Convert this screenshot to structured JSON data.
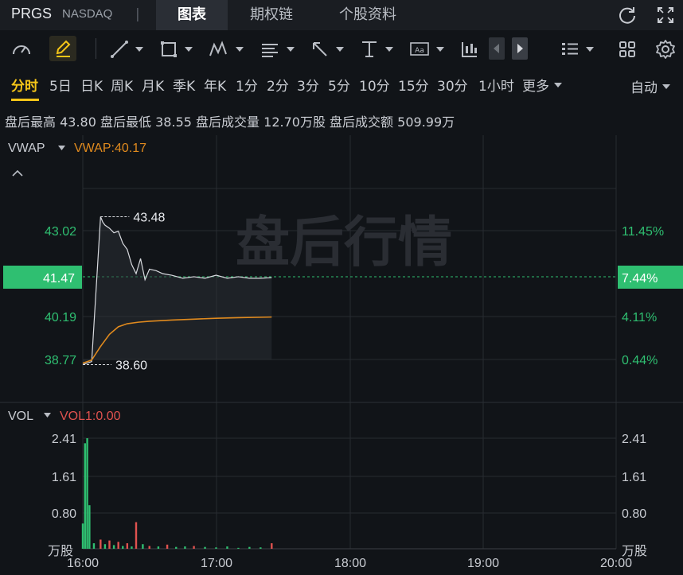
{
  "header": {
    "ticker": "PRGS",
    "exchange": "NASDAQ",
    "separator": "|",
    "tabs": [
      {
        "label": "图表",
        "active": true
      },
      {
        "label": "期权链",
        "active": false
      },
      {
        "label": "个股资料",
        "active": false
      }
    ],
    "icons": [
      "refresh-icon",
      "fullscreen-icon"
    ]
  },
  "toolbar": {
    "icons": [
      "gauge-icon",
      "pen-icon",
      "trend-line-icon",
      "rectangle-icon",
      "pattern-icon",
      "fibonacci-icon",
      "arrow-icon",
      "level-icon",
      "text-icon",
      "indicator-icon",
      "prev-icon",
      "next-icon",
      "layout-icon",
      "grid-icon",
      "settings-icon"
    ]
  },
  "periods": {
    "items": [
      "分时",
      "5日",
      "日K",
      "周K",
      "月K",
      "季K",
      "年K",
      "1分",
      "2分",
      "3分",
      "5分",
      "10分",
      "15分",
      "30分",
      "1小时",
      "更多"
    ],
    "active": "分时",
    "auto_label": "自动"
  },
  "info": {
    "items": [
      {
        "label": "盘后最高",
        "value": "43.80"
      },
      {
        "label": "盘后最低",
        "value": "38.55"
      },
      {
        "label": "盘后成交量",
        "value": "12.70万股"
      },
      {
        "label": "盘后成交额",
        "value": "509.99万"
      }
    ]
  },
  "price_panel": {
    "indicator": "VWAP",
    "indicator_value": "VWAP:40.17",
    "watermark": "盘后行情",
    "left_ticks": [
      "43.02",
      "41.47",
      "40.19",
      "38.77"
    ],
    "right_ticks": [
      "11.45%",
      "7.44%",
      "4.11%",
      "0.44%"
    ],
    "current_price": "41.47",
    "current_pct": "7.44%",
    "high_label": "43.48",
    "low_label": "38.60",
    "collapse_icon": "chevron-up-icon"
  },
  "volume_panel": {
    "indicator": "VOL",
    "indicator_value": "VOL1:0.00",
    "left_ticks": [
      "2.41",
      "1.61",
      "0.80"
    ],
    "right_ticks": [
      "2.41",
      "1.61",
      "0.80"
    ],
    "unit_left": "万股",
    "unit_right": "万股"
  },
  "time_axis": [
    "16:00",
    "17:00",
    "18:00",
    "19:00",
    "20:00"
  ],
  "colors": {
    "background": "#111418",
    "accent": "#f5c518",
    "up": "#2fbf71",
    "down": "#e0524f",
    "vwap": "#e08a1e",
    "price_line": "#d8dadf"
  },
  "chart_data": [
    {
      "type": "line",
      "title": "",
      "x_range": [
        "16:00",
        "20:00"
      ],
      "ylim": [
        38.0,
        44.5
      ],
      "series": [
        {
          "name": "",
          "x": [
            "16:00",
            "16:04",
            "16:08",
            "16:09",
            "16:10",
            "16:12",
            "16:14",
            "16:16",
            "16:18",
            "16:20",
            "16:22",
            "16:24",
            "16:26",
            "16:28",
            "16:30",
            "16:33",
            "16:36",
            "16:40",
            "16:45",
            "16:50",
            "16:55",
            "17:00",
            "17:05",
            "17:10",
            "17:15",
            "17:20",
            "17:25"
          ],
          "values": [
            38.6,
            38.7,
            43.48,
            43.3,
            43.2,
            43.1,
            42.95,
            43.0,
            42.6,
            42.4,
            41.9,
            41.6,
            42.1,
            41.4,
            41.75,
            41.7,
            41.6,
            41.55,
            41.45,
            41.5,
            41.45,
            41.55,
            41.45,
            41.5,
            41.45,
            41.45,
            41.47
          ]
        },
        {
          "name": "VWAP",
          "x": [
            "16:00",
            "16:04",
            "16:08",
            "16:12",
            "16:16",
            "16:20",
            "16:25",
            "16:30",
            "16:40",
            "16:50",
            "17:00",
            "17:10",
            "17:25"
          ],
          "values": [
            38.65,
            38.75,
            39.2,
            39.6,
            39.85,
            39.95,
            40.0,
            40.03,
            40.07,
            40.1,
            40.13,
            40.15,
            40.17
          ]
        }
      ]
    },
    {
      "type": "bar",
      "title": "",
      "ylabel": "万股",
      "ylim": [
        0,
        2.6
      ],
      "x": [
        "16:00",
        "16:01",
        "16:02",
        "16:03",
        "16:05",
        "16:08",
        "16:10",
        "16:12",
        "16:14",
        "16:16",
        "16:18",
        "16:20",
        "16:22",
        "16:24",
        "16:27",
        "16:30",
        "16:34",
        "16:38",
        "16:42",
        "16:46",
        "16:50",
        "16:55",
        "17:00",
        "17:05",
        "17:10",
        "17:15",
        "17:20",
        "17:25"
      ],
      "values": [
        0.55,
        2.3,
        2.41,
        0.95,
        0.12,
        0.2,
        0.1,
        0.18,
        0.08,
        0.15,
        0.06,
        0.12,
        0.05,
        0.58,
        0.1,
        0.06,
        0.05,
        0.09,
        0.04,
        0.05,
        0.06,
        0.04,
        0.03,
        0.05,
        0.02,
        0.04,
        0.03,
        0.12
      ],
      "colors": [
        "up",
        "up",
        "up",
        "up",
        "up",
        "down",
        "up",
        "down",
        "up",
        "down",
        "up",
        "down",
        "up",
        "down",
        "up",
        "down",
        "up",
        "down",
        "up",
        "up",
        "down",
        "up",
        "up",
        "up",
        "up",
        "up",
        "up",
        "down"
      ]
    }
  ]
}
